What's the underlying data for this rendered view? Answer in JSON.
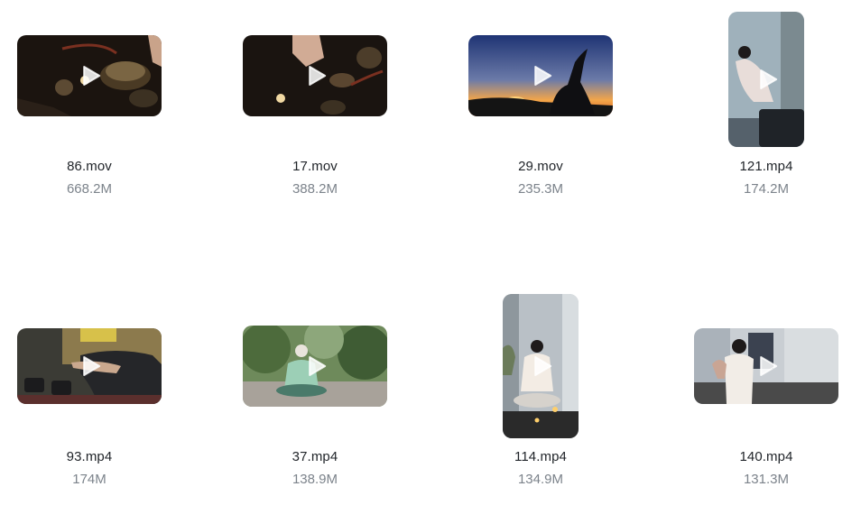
{
  "files": [
    {
      "name": "86.mov",
      "size": "668.2M",
      "scene": "singing-bowls"
    },
    {
      "name": "17.mov",
      "size": "388.2M",
      "scene": "singing-bowls-hand"
    },
    {
      "name": "29.mov",
      "size": "235.3M",
      "scene": "sunset-yoga"
    },
    {
      "name": "121.mp4",
      "size": "174.2M",
      "scene": "meditation-portrait"
    },
    {
      "name": "93.mp4",
      "size": "174M",
      "scene": "yoga-dumbbells"
    },
    {
      "name": "37.mp4",
      "size": "138.9M",
      "scene": "garden-meditation"
    },
    {
      "name": "114.mp4",
      "size": "134.9M",
      "scene": "candle-meditation"
    },
    {
      "name": "140.mp4",
      "size": "131.3M",
      "scene": "bedroom-prayer"
    }
  ],
  "icons": {
    "play": "play-icon"
  }
}
